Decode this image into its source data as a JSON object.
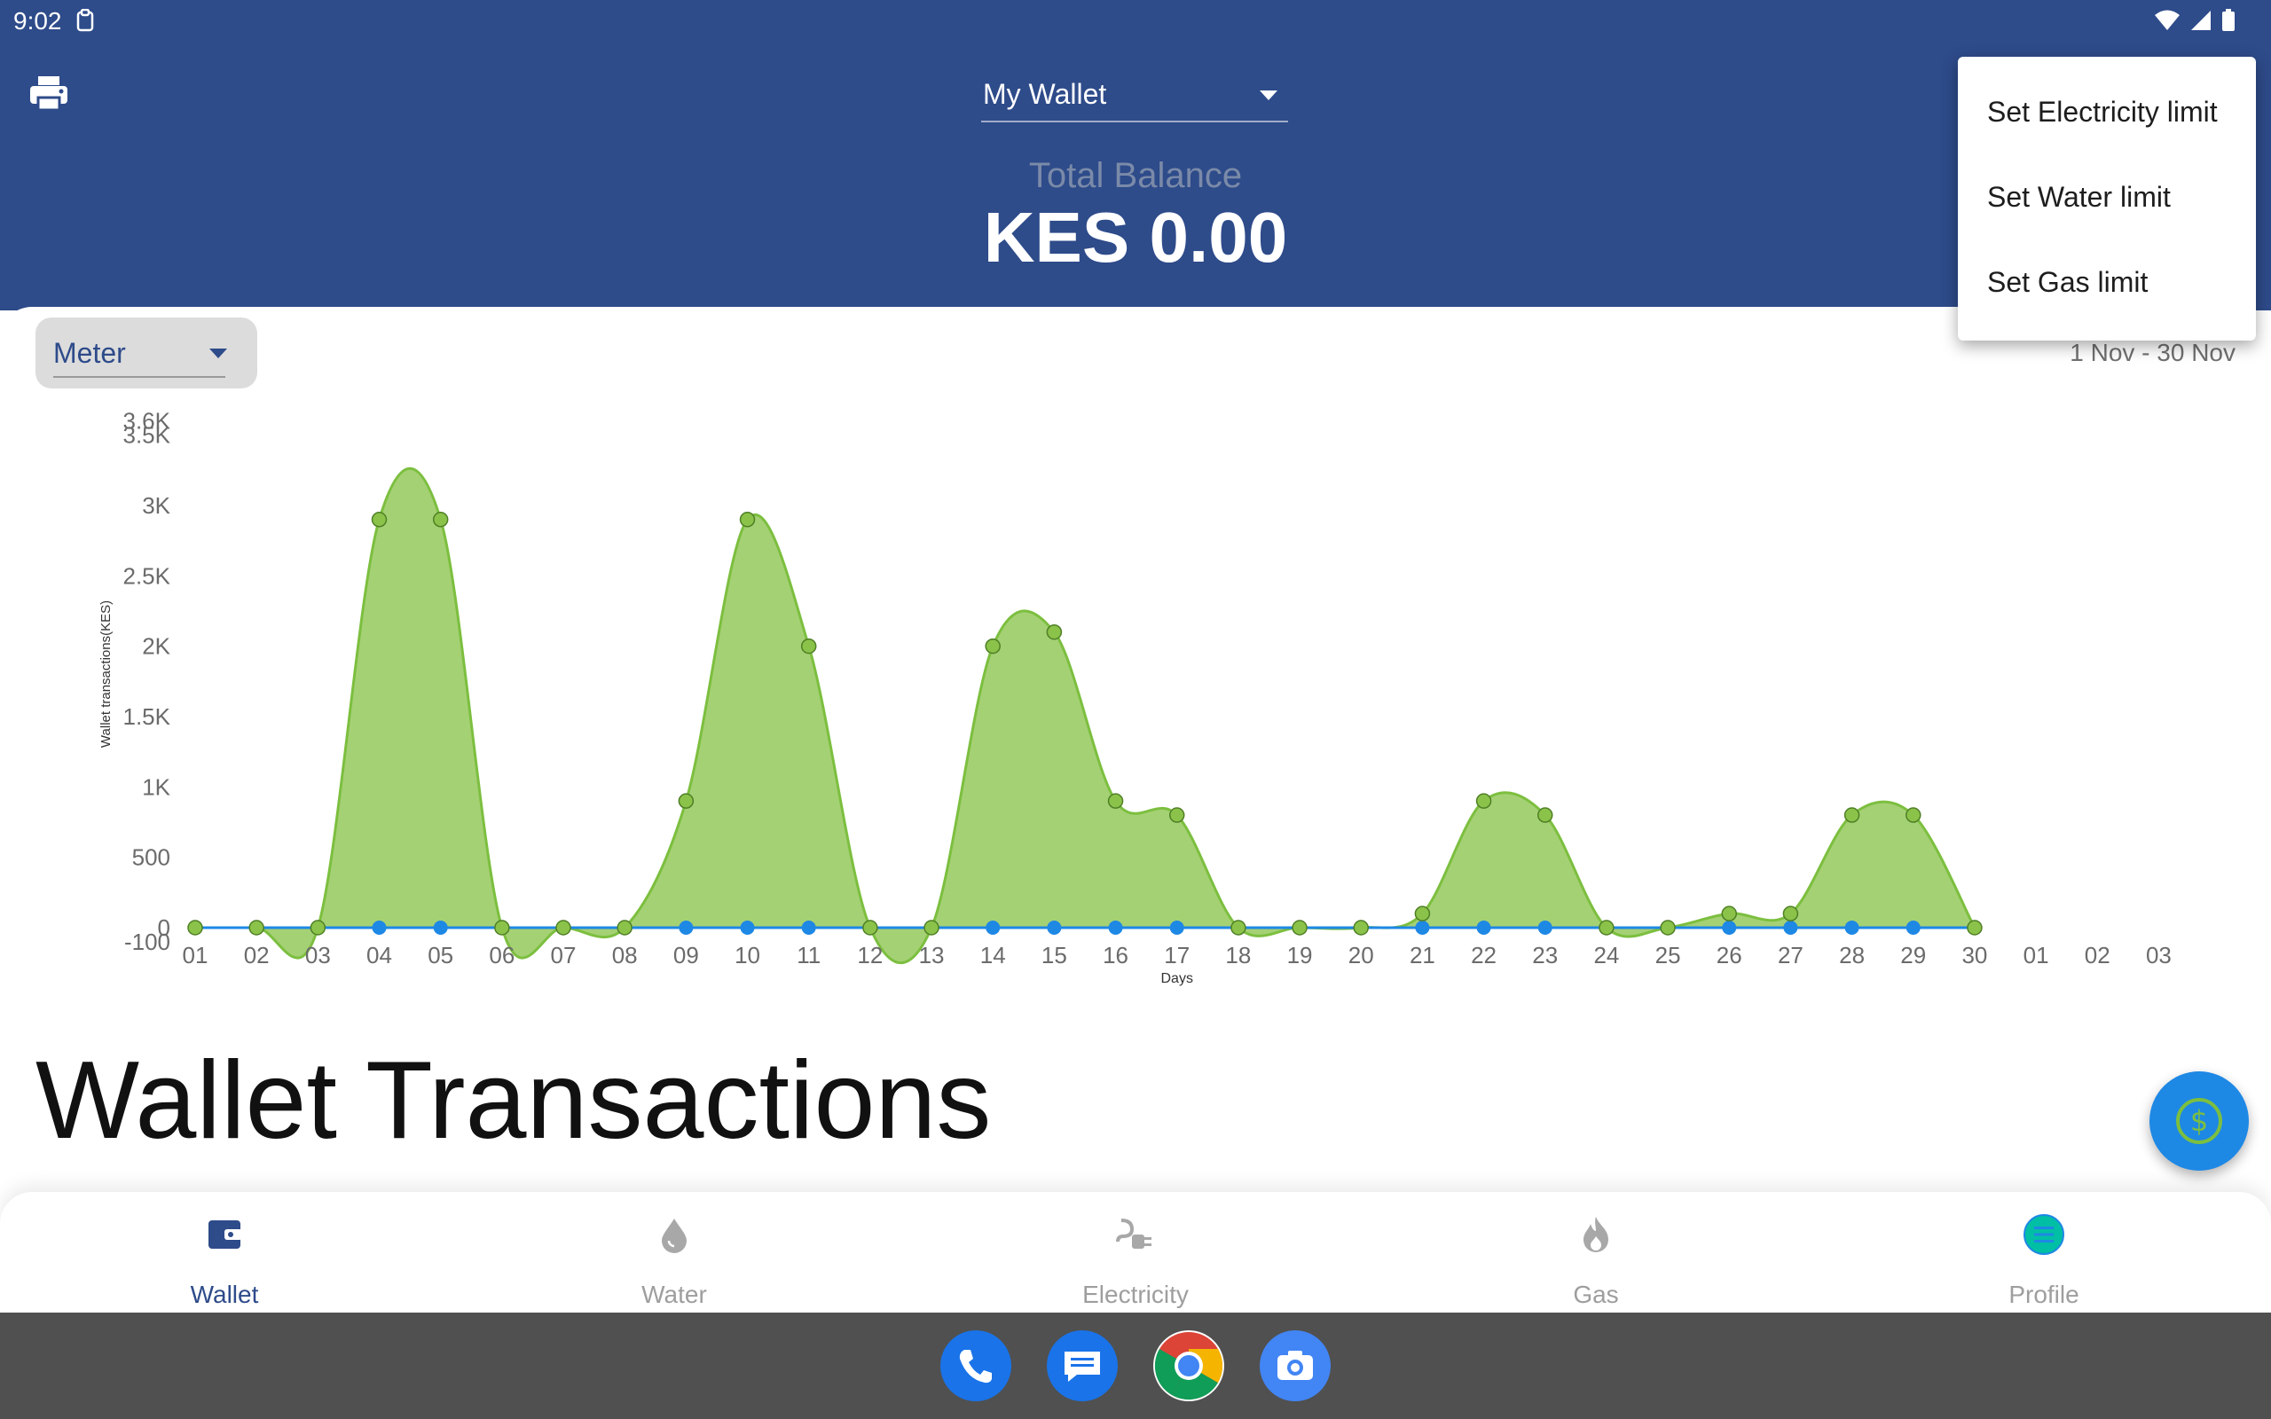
{
  "status": {
    "time": "9:02"
  },
  "header": {
    "wallet_select": "My Wallet",
    "balance_label": "Total Balance",
    "balance_value": "KES 0.00"
  },
  "filters": {
    "meter_select": "Meter",
    "date_range": "1 Nov - 30 Nov"
  },
  "popup_menu": {
    "items": [
      "Set Electricity limit",
      "Set Water limit",
      "Set Gas limit"
    ]
  },
  "section_title": "Wallet Transactions",
  "bottom_nav": {
    "items": [
      {
        "label": "Wallet",
        "icon": "wallet-icon",
        "active": true
      },
      {
        "label": "Water",
        "icon": "water-drop-icon",
        "active": false
      },
      {
        "label": "Electricity",
        "icon": "plug-icon",
        "active": false
      },
      {
        "label": "Gas",
        "icon": "flame-icon",
        "active": false
      },
      {
        "label": "Profile",
        "icon": "profile-menu-icon",
        "active": false
      }
    ]
  },
  "dock": {
    "apps": [
      "phone-app-icon",
      "messages-app-icon",
      "chrome-app-icon",
      "camera-app-icon"
    ]
  },
  "colors": {
    "header": "#2e4b8a",
    "series_green_fill": "#a5d175",
    "series_green_stroke": "#7cbf3f",
    "series_blue": "#1e88e5",
    "fab": "#1e88e5"
  },
  "chart_data": {
    "type": "area",
    "xlabel": "Days",
    "ylabel": "Wallet transactions(KES)",
    "categories": [
      "01",
      "02",
      "03",
      "04",
      "05",
      "06",
      "07",
      "08",
      "09",
      "10",
      "11",
      "12",
      "13",
      "14",
      "15",
      "16",
      "17",
      "18",
      "19",
      "20",
      "21",
      "22",
      "23",
      "24",
      "25",
      "26",
      "27",
      "28",
      "29",
      "30",
      "01",
      "02",
      "03"
    ],
    "ylim": [
      -100,
      3600
    ],
    "y_ticks": [
      "-100",
      "0",
      "500",
      "1K",
      "1.5K",
      "2K",
      "2.5K",
      "3K",
      "3.5K",
      "3.6K"
    ],
    "y_tick_values": [
      -100,
      0,
      500,
      1000,
      1500,
      2000,
      2500,
      3000,
      3500,
      3600
    ],
    "series": [
      {
        "values": [
          0,
          0,
          0,
          2900,
          2900,
          0,
          0,
          0,
          900,
          2900,
          2000,
          0,
          0,
          2000,
          2100,
          900,
          800,
          0,
          0,
          0,
          100,
          900,
          800,
          0,
          0,
          100,
          100,
          800,
          800,
          0
        ]
      },
      {
        "values": [
          0,
          0,
          0,
          0,
          0,
          0,
          0,
          0,
          0,
          0,
          0,
          0,
          0,
          0,
          0,
          0,
          0,
          0,
          0,
          0,
          0,
          0,
          0,
          0,
          0,
          0,
          0,
          0,
          0,
          0
        ]
      }
    ]
  }
}
